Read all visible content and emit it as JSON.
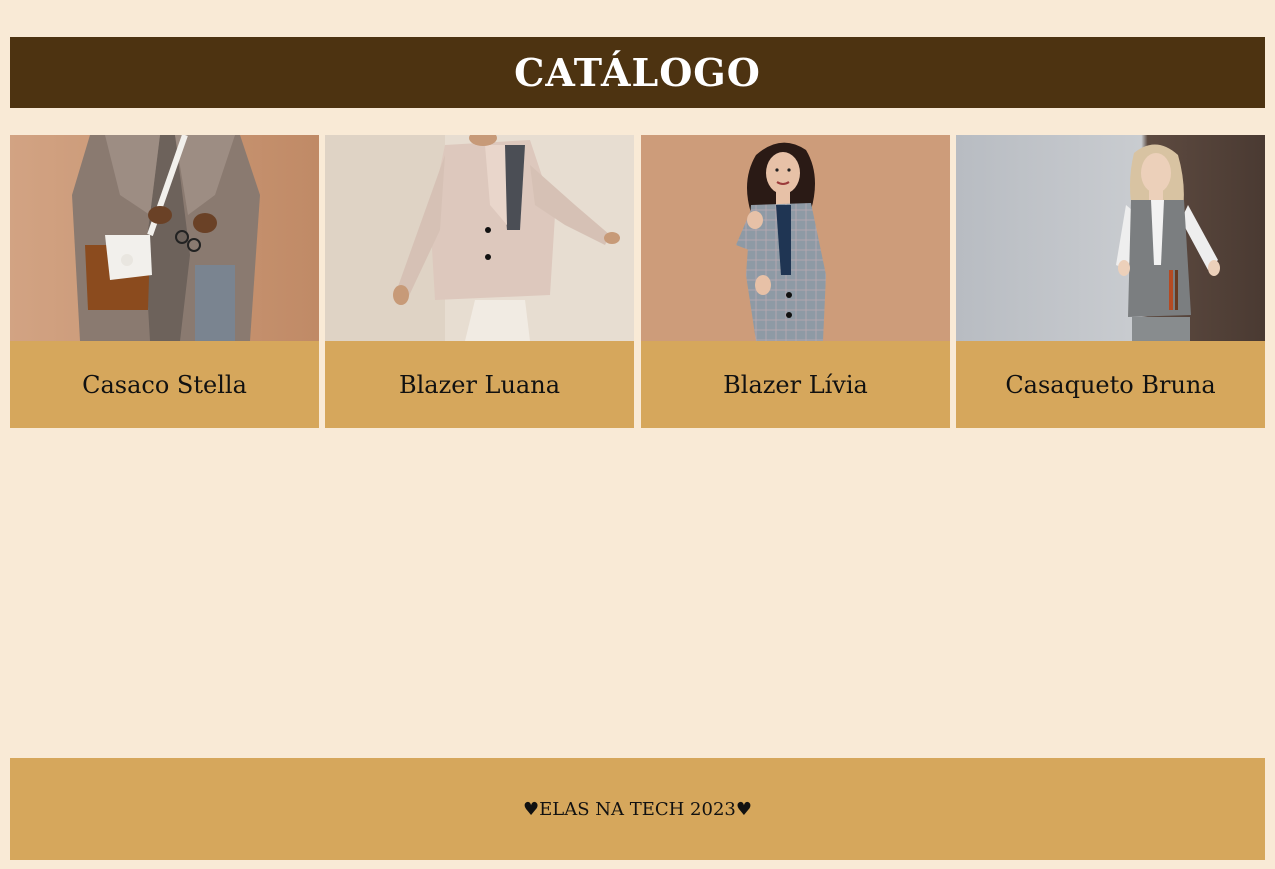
{
  "header": {
    "title": "CATÁLOGO"
  },
  "products": [
    {
      "name": "Casaco Stella",
      "photo_icon": "coat-model-photo"
    },
    {
      "name": "Blazer Luana",
      "photo_icon": "blazer-model-photo"
    },
    {
      "name": "Blazer Lívia",
      "photo_icon": "plaid-blazer-model-photo"
    },
    {
      "name": "Casaqueto Bruna",
      "photo_icon": "vest-model-photo"
    }
  ],
  "footer": {
    "text": "♥ELAS NA TECH 2023♥"
  },
  "colors": {
    "page_background": "#f9ead6",
    "header_background": "#4d3311",
    "card_caption_background": "#d6a75c",
    "footer_background": "#d6a75c"
  }
}
